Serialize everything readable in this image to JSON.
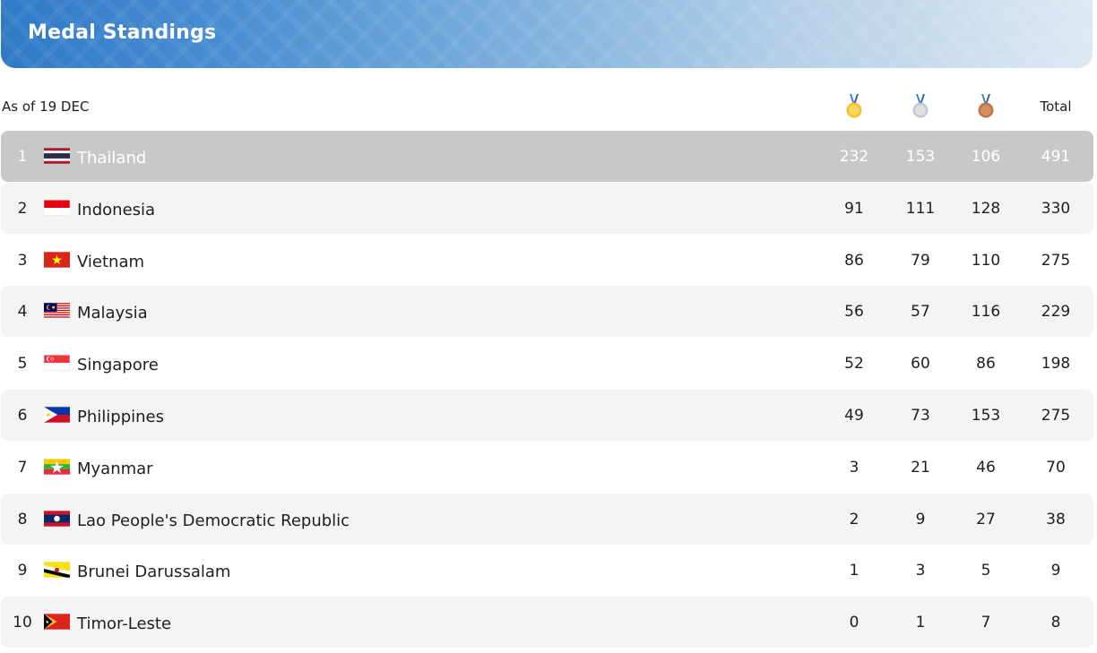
{
  "banner": {
    "title": "Medal Standings"
  },
  "header": {
    "as_of": "As of 19 DEC",
    "total_label": "Total",
    "icons": [
      "gold-medal-icon",
      "silver-medal-icon",
      "bronze-medal-icon"
    ]
  },
  "colors": {
    "gold": "#f2c12e",
    "silver": "#c4c9cf",
    "bronze": "#b9774b",
    "highlight_row": "#c8c8c8",
    "alt_row": "#f4f4f4"
  },
  "rows": [
    {
      "rank": "1",
      "country": "Thailand",
      "flag": "thailand-flag-icon",
      "gold": "232",
      "silver": "153",
      "bronze": "106",
      "total": "491"
    },
    {
      "rank": "2",
      "country": "Indonesia",
      "flag": "indonesia-flag-icon",
      "gold": "91",
      "silver": "111",
      "bronze": "128",
      "total": "330"
    },
    {
      "rank": "3",
      "country": "Vietnam",
      "flag": "vietnam-flag-icon",
      "gold": "86",
      "silver": "79",
      "bronze": "110",
      "total": "275"
    },
    {
      "rank": "4",
      "country": "Malaysia",
      "flag": "malaysia-flag-icon",
      "gold": "56",
      "silver": "57",
      "bronze": "116",
      "total": "229"
    },
    {
      "rank": "5",
      "country": "Singapore",
      "flag": "singapore-flag-icon",
      "gold": "52",
      "silver": "60",
      "bronze": "86",
      "total": "198"
    },
    {
      "rank": "6",
      "country": "Philippines",
      "flag": "philippines-flag-icon",
      "gold": "49",
      "silver": "73",
      "bronze": "153",
      "total": "275"
    },
    {
      "rank": "7",
      "country": "Myanmar",
      "flag": "myanmar-flag-icon",
      "gold": "3",
      "silver": "21",
      "bronze": "46",
      "total": "70"
    },
    {
      "rank": "8",
      "country": "Lao People's Democratic Republic",
      "flag": "laos-flag-icon",
      "gold": "2",
      "silver": "9",
      "bronze": "27",
      "total": "38"
    },
    {
      "rank": "9",
      "country": "Brunei Darussalam",
      "flag": "brunei-flag-icon",
      "gold": "1",
      "silver": "3",
      "bronze": "5",
      "total": "9"
    },
    {
      "rank": "10",
      "country": "Timor-Leste",
      "flag": "timor-leste-flag-icon",
      "gold": "0",
      "silver": "1",
      "bronze": "7",
      "total": "8"
    }
  ]
}
